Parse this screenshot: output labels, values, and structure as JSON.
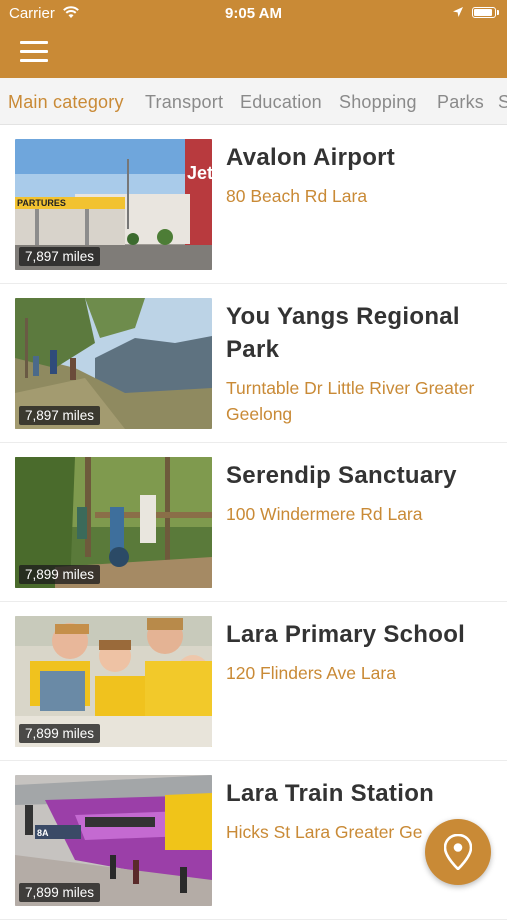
{
  "status_bar": {
    "carrier": "Carrier",
    "time": "9:05 AM",
    "battery_level": 0.95
  },
  "header": {
    "menu_icon": "hamburger-menu-icon"
  },
  "tabs": [
    {
      "label": "Main category",
      "active": true
    },
    {
      "label": "Transport",
      "active": false
    },
    {
      "label": "Education",
      "active": false
    },
    {
      "label": "Shopping",
      "active": false
    },
    {
      "label": "Parks",
      "active": false
    },
    {
      "label": "S",
      "active": false
    }
  ],
  "places": [
    {
      "title": "Avalon Airport",
      "address": "80 Beach Rd Lara",
      "distance": "7,897 miles"
    },
    {
      "title": "You Yangs Regional Park",
      "address": "Turntable Dr Little River Greater Geelong",
      "distance": "7,897 miles"
    },
    {
      "title": "Serendip Sanctuary",
      "address": "100 Windermere Rd Lara",
      "distance": "7,899 miles"
    },
    {
      "title": "Lara Primary School",
      "address": "120 Flinders Ave Lara",
      "distance": "7,899 miles"
    },
    {
      "title": "Lara Train Station",
      "address": "Hicks St Lara Greater Ge",
      "distance": "7,899 miles"
    }
  ],
  "fab": {
    "icon": "map-pin-icon"
  },
  "colors": {
    "accent": "#c98a36",
    "text": "#333333",
    "tab_inactive": "#8a8a8a"
  }
}
